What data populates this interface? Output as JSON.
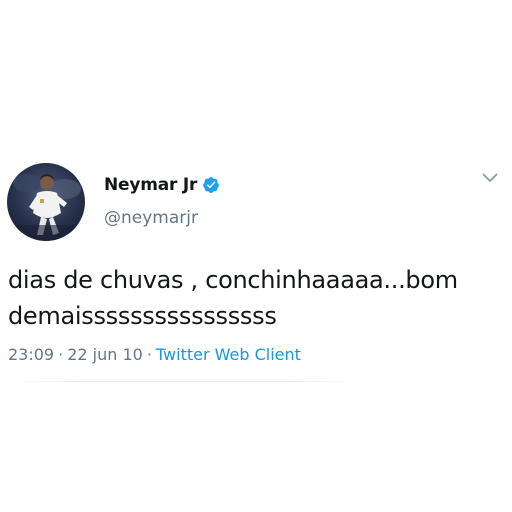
{
  "user": {
    "display_name": "Neymar Jr",
    "handle": "@neymarjr",
    "verified_icon": "verified-badge-icon",
    "verified_color": "#1da1f2"
  },
  "tweet": {
    "text_lines": [
      "dias de chuvas , conchinhaaaaa...bom",
      "demaissssssssssssssss"
    ]
  },
  "meta": {
    "time": "23:09",
    "separator": "·",
    "date": "22 jun 10",
    "source": "Twitter Web Client"
  },
  "colors": {
    "text": "#14171a",
    "secondary": "#657786",
    "link": "#1b95e0",
    "divider": "#e6ecf0"
  },
  "icons": {
    "more": "chevron-down-icon"
  }
}
